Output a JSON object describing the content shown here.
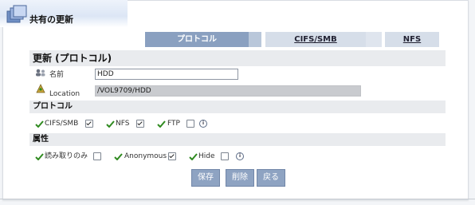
{
  "header": {
    "title": "共有の更新"
  },
  "tabs": [
    {
      "label": "プロトコル",
      "active": true
    },
    {
      "label": "CIFS/SMB",
      "active": false
    },
    {
      "label": "NFS",
      "active": false
    }
  ],
  "form": {
    "section_title": "更新 (プロトコル)",
    "name_label": "名前",
    "name_value": "HDD",
    "location_label": "Location",
    "location_value": "/VOL9709/HDD"
  },
  "protocol": {
    "title": "プロトコル",
    "options": [
      {
        "label": "CIFS/SMB",
        "checked": true
      },
      {
        "label": "NFS",
        "checked": true
      },
      {
        "label": "FTP",
        "checked": false
      }
    ]
  },
  "attributes": {
    "title": "属性",
    "options": [
      {
        "label": "読み取りのみ",
        "checked": false
      },
      {
        "label": "Anonymous",
        "checked": true
      },
      {
        "label": "Hide",
        "checked": false
      }
    ]
  },
  "buttons": {
    "save": "保存",
    "delete": "削除",
    "back": "戻る"
  },
  "colors": {
    "accent": "#8ea3c2",
    "check_green": "#2f8a1f",
    "section_bg": "#e9ebee"
  }
}
